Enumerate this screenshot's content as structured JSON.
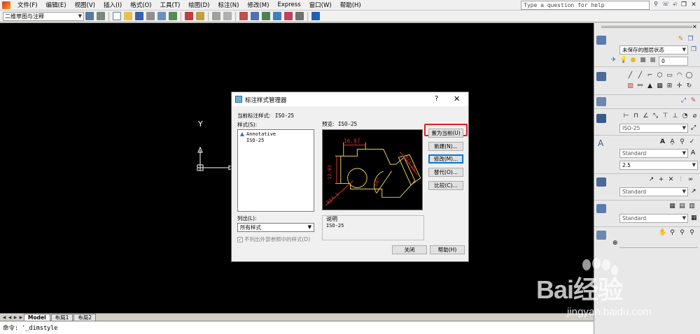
{
  "menubar": {
    "items": [
      "文件(F)",
      "编辑(E)",
      "视图(V)",
      "插入(I)",
      "格式(O)",
      "工具(T)",
      "绘图(D)",
      "标注(N)",
      "修改(M)",
      "Express",
      "窗口(W)",
      "帮助(H)"
    ],
    "help_placeholder": "Type a question for help"
  },
  "toolbar": {
    "workspace": "二维草图与注释"
  },
  "tabs": [
    "Model",
    "布局1",
    "布局2"
  ],
  "command_line": "命令: '_dimstyle",
  "ucs": {
    "y_label": "Y"
  },
  "right_panel": {
    "layer_state": "未保存的图层状态",
    "layer_value": "0",
    "dim_style": "ISO-25",
    "text_style": "Standard",
    "text_height": "2.5",
    "multileader_style": "Standard",
    "table_style": "Standard"
  },
  "dialog": {
    "title": "标注样式管理器",
    "help": "?",
    "close": "✕",
    "current_style_label": "当前标注样式:",
    "current_style_value": "ISO-25",
    "styles_label": "样式(S):",
    "styles": [
      "Annotative",
      "ISO-25"
    ],
    "preview_label": "预览:",
    "preview_value": "ISO-25",
    "list_label": "列出(L):",
    "list_value": "所有样式",
    "xref_label": "不列出外部参照中的样式(D)",
    "desc_label": "说明",
    "desc_value": "ISO-25",
    "preview_dims": {
      "top": "16.97",
      "left": "12.03",
      "right": "R11.05",
      "arc": "60°",
      "bottom": "R14.1"
    },
    "buttons": {
      "set_current": "置为当前(U)",
      "new": "新建(N)...",
      "modify": "修改(M)...",
      "override": "替代(O)...",
      "compare": "比较(C)...",
      "close": "关闭",
      "help": "帮助(H)"
    }
  },
  "watermark": {
    "text": "Bai经验",
    "url": "jingyan.baidu.com"
  }
}
